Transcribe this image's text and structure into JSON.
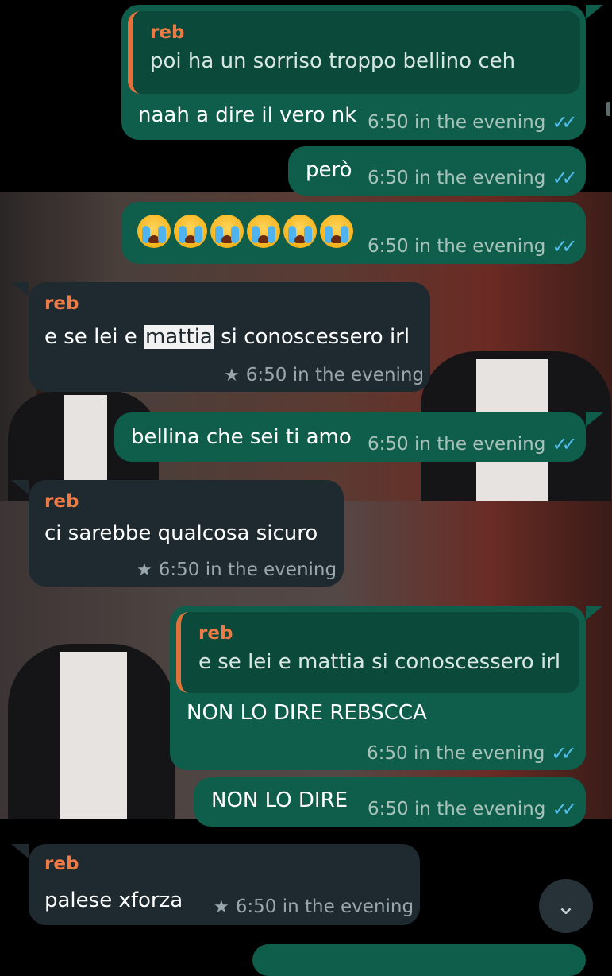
{
  "messages": {
    "m1": {
      "quote_sender": "reb",
      "quote_text": "poi ha un sorriso troppo bellino ceh",
      "text": "naah a dire il vero nk",
      "time": "6:50 in the evening"
    },
    "m2": {
      "text": "però",
      "time": "6:50 in the evening"
    },
    "m3": {
      "emoji_icons": [
        "crying-face-icon",
        "crying-face-icon",
        "crying-face-icon",
        "crying-face-icon",
        "crying-face-icon",
        "crying-face-icon"
      ],
      "time": "6:50 in the evening"
    },
    "m4": {
      "sender": "reb",
      "text_before": "e se lei e ",
      "text_highlight": "mattia",
      "text_after": " si conoscessero irl",
      "time": "6:50 in the evening",
      "starred": true
    },
    "m5": {
      "text": "bellina che sei ti amo",
      "time": "6:50 in the evening"
    },
    "m6": {
      "sender": "reb",
      "text": "ci sarebbe qualcosa sicuro",
      "time": "6:50 in the evening",
      "starred": true
    },
    "m7": {
      "quote_sender": "reb",
      "quote_text": "e se lei e mattia si conoscessero irl",
      "text": "NON LO DIRE REBSCCA",
      "time": "6:50 in the evening"
    },
    "m8": {
      "text": "NON LO DIRE",
      "time": "6:50 in the evening"
    },
    "m9": {
      "sender": "reb",
      "text": "palese xforza",
      "time": "6:50 in the evening",
      "starred": true
    }
  },
  "icons": {
    "read_receipt": "double-check-icon",
    "star": "star-icon",
    "scroll": "chevron-double-down-icon"
  },
  "colors": {
    "outgoing": "#0f5e4b",
    "incoming": "#1f2a30",
    "sender_name": "#ee7a45",
    "read_tick": "#53bdeb"
  }
}
